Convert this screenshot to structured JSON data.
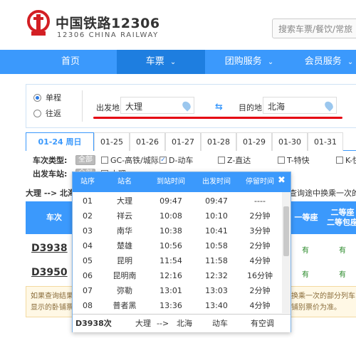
{
  "header": {
    "logo_cn": "中国铁路12306",
    "logo_en": "12306 CHINA RAILWAY",
    "search_placeholder": "搜索车票/餐饮/常旅"
  },
  "nav": {
    "items": [
      {
        "label": "首页",
        "dropdown": false
      },
      {
        "label": "车票",
        "dropdown": true
      },
      {
        "label": "团购服务",
        "dropdown": true
      },
      {
        "label": "会员服务",
        "dropdown": true
      }
    ]
  },
  "query": {
    "trip_types": [
      {
        "label": "单程",
        "selected": true
      },
      {
        "label": "往返",
        "selected": false
      }
    ],
    "from_label": "出发地",
    "from_value": "大理",
    "to_label": "目的地",
    "to_value": "北海",
    "swap_icon": "swap-arrows-icon"
  },
  "dates": [
    {
      "label": "01-24 周日",
      "active": true
    },
    {
      "label": "01-25"
    },
    {
      "label": "01-26"
    },
    {
      "label": "01-27"
    },
    {
      "label": "01-28"
    },
    {
      "label": "01-29"
    },
    {
      "label": "01-30"
    },
    {
      "label": "01-31"
    }
  ],
  "filters": {
    "train_type_label": "车次类型:",
    "all_label": "全部",
    "types": [
      {
        "label": "GC-高铁/城际",
        "checked": false
      },
      {
        "label": "D-动车",
        "checked": true
      },
      {
        "label": "Z-直达",
        "checked": false
      },
      {
        "label": "T-特快",
        "checked": false
      },
      {
        "label": "K-快",
        "checked": false
      }
    ],
    "depart_station_label": "出发车站:",
    "depart_stations": [
      {
        "label": "大理",
        "checked": false
      }
    ]
  },
  "results": {
    "route_left": "大理 --> 北海",
    "route_right": "查询途中换乘一次的",
    "headers": {
      "train": "车次",
      "first_class": "一等座",
      "second_class": "二等座\n二等包座"
    },
    "rows": [
      {
        "train": "D3938",
        "first": "有",
        "second": "有"
      },
      {
        "train": "D3950",
        "first": "有",
        "second": "有"
      }
    ],
    "notice_left": "如果查询结果",
    "notice_left2": "显示的卧铺票",
    "notice_right": "换乘一次的部分列车",
    "notice_right2": "铺别票价为准。"
  },
  "popup": {
    "columns": [
      "站序",
      "站名",
      "到站时间",
      "出发时间",
      "停留时间"
    ],
    "close_icon": "close-icon",
    "stops": [
      {
        "seq": "01",
        "name": "大理",
        "arrive": "09:47",
        "depart": "09:47",
        "stay": "----"
      },
      {
        "seq": "02",
        "name": "祥云",
        "arrive": "10:08",
        "depart": "10:10",
        "stay": "2分钟"
      },
      {
        "seq": "03",
        "name": "南华",
        "arrive": "10:38",
        "depart": "10:41",
        "stay": "3分钟"
      },
      {
        "seq": "04",
        "name": "楚雄",
        "arrive": "10:56",
        "depart": "10:58",
        "stay": "2分钟"
      },
      {
        "seq": "05",
        "name": "昆明",
        "arrive": "11:54",
        "depart": "11:58",
        "stay": "4分钟"
      },
      {
        "seq": "06",
        "name": "昆明南",
        "arrive": "12:16",
        "depart": "12:32",
        "stay": "16分钟"
      },
      {
        "seq": "07",
        "name": "弥勒",
        "arrive": "13:01",
        "depart": "13:03",
        "stay": "2分钟"
      },
      {
        "seq": "08",
        "name": "普者黑",
        "arrive": "13:36",
        "depart": "13:40",
        "stay": "4分钟"
      }
    ],
    "footer": {
      "train": "D3938次",
      "from": "大理",
      "arrow": "-->",
      "to": "北海",
      "type": "动车",
      "ac": "有空调"
    }
  },
  "colors": {
    "brand_blue": "#3b99fc",
    "nav_active": "#1e7ee0",
    "underline_red": "#e50012",
    "logo_red": "#d31f24"
  }
}
